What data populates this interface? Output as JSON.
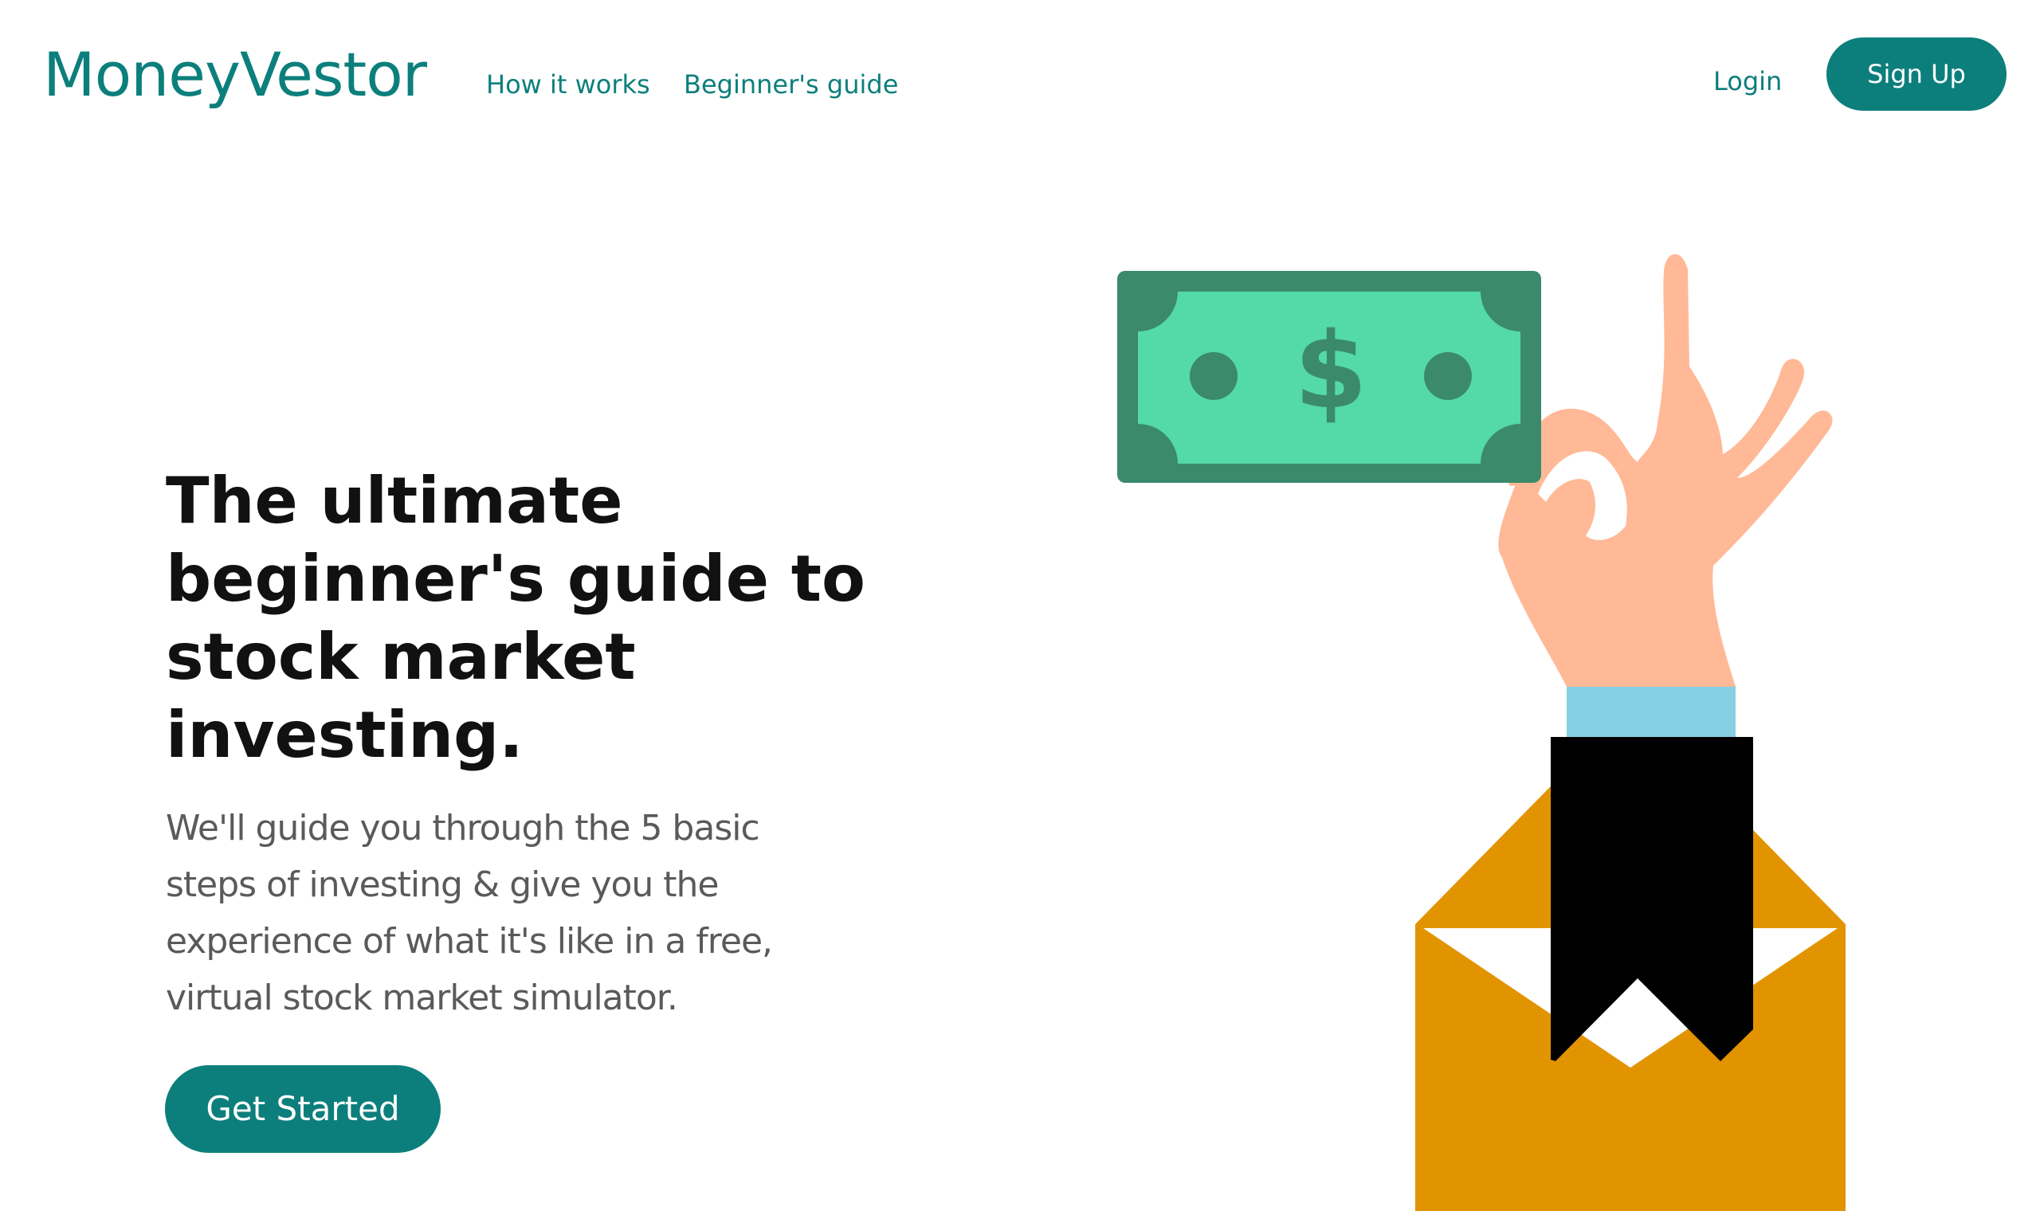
{
  "header": {
    "brand": "MoneyVestor",
    "nav": [
      {
        "label": "How it works"
      },
      {
        "label": "Beginner's guide"
      }
    ],
    "login_label": "Login",
    "signup_label": "Sign Up"
  },
  "hero": {
    "title": "The ultimate beginner's guide to stock market investing.",
    "subtitle": "We'll guide you through the 5 basic steps of investing & give you the experience of what it's like in a free, virtual stock market simulator.",
    "cta_label": "Get Started",
    "illustration_icons": [
      "dollar-bill-icon",
      "hand-ok-icon",
      "envelope-icon"
    ]
  },
  "colors": {
    "brand": "#0c7f7c",
    "bill_dark": "#3b8a6b",
    "bill_light": "#54d9a8",
    "skin": "#ffb996",
    "cuff": "#86d0e3",
    "sleeve": "#000000",
    "envelope": "#e29400"
  }
}
